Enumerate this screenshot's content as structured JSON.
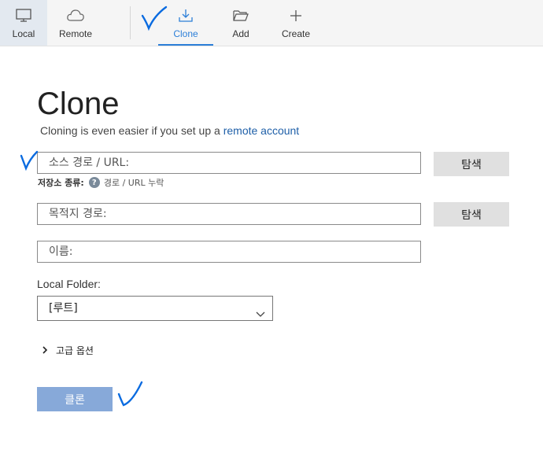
{
  "toolbar": {
    "local": "Local",
    "remote": "Remote",
    "clone": "Clone",
    "add": "Add",
    "create": "Create"
  },
  "main": {
    "title": "Clone",
    "subtitle_prefix": "Cloning is even easier if you set up a ",
    "subtitle_link": "remote account",
    "source_placeholder": "소스 경로 / URL:",
    "browse_label": "탐색",
    "repo_type_label": "저장소 종류:",
    "repo_type_value": "경로 / URL 누락",
    "destination_placeholder": "목적지 경로:",
    "name_placeholder": "이름:",
    "local_folder_label": "Local Folder:",
    "local_folder_value": "[루트]",
    "advanced_label": "고급 옵션",
    "clone_button": "클론"
  },
  "colors": {
    "accent": "#2c7fd8",
    "clone_button": "#87a9d9",
    "link": "#1e5fa8",
    "annotation": "#0a6be0"
  }
}
